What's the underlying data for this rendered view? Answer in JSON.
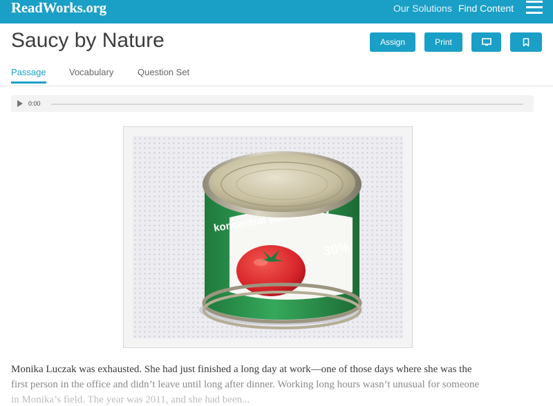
{
  "header": {
    "logo": "ReadWorks.org",
    "nav": {
      "solutions": "Our Solutions",
      "find": "Find Content"
    }
  },
  "article": {
    "title": "Saucy by Nature",
    "buttons": {
      "assign": "Assign",
      "print": "Print"
    },
    "icons": {
      "present": "monitor-icon",
      "bookmark": "bookmark-icon",
      "menu": "hamburger-icon"
    }
  },
  "tabs": [
    {
      "label": "Passage",
      "active": true
    },
    {
      "label": "Vocabulary",
      "active": false
    },
    {
      "label": "Question Set",
      "active": false
    }
  ],
  "audio": {
    "time": "0:00"
  },
  "image": {
    "can_text": "koncentrat pomidorowy",
    "can_percent": "30%"
  },
  "passage": {
    "lines": [
      "Monika Luczak was exhausted. She had just finished a long day at work—one of those days where she was the",
      "first person in the office and didn’t leave until long after dinner. Working long hours wasn’t unusual for someone",
      "in Monika’s field. The year was 2011, and she had been..."
    ]
  },
  "colors": {
    "brand": "#1a9fc6",
    "title": "#3c3c3c",
    "tomato": "#d8262b",
    "can_green": "#2e9a52"
  }
}
